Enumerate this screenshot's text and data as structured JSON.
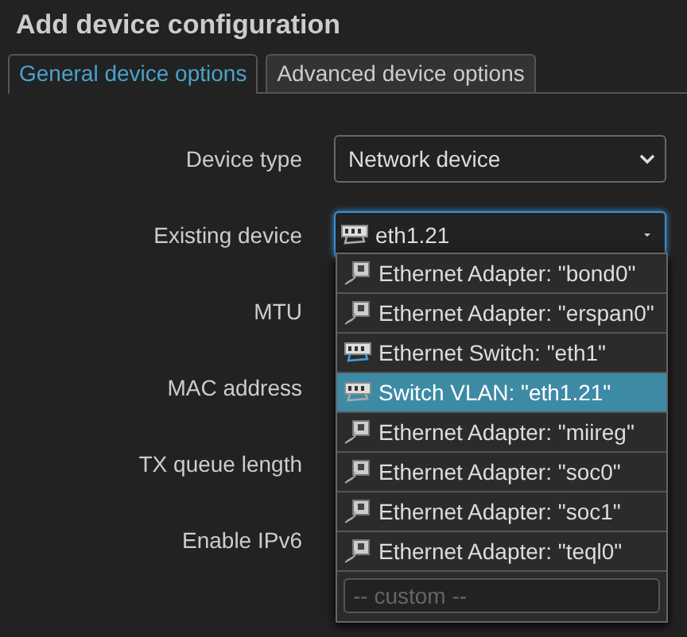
{
  "title": "Add device configuration",
  "tabs": [
    {
      "label": "General device options",
      "selected": true
    },
    {
      "label": "Advanced device options",
      "selected": false
    }
  ],
  "fields": [
    {
      "label": "Device type",
      "kind": "select",
      "value": "Network device"
    },
    {
      "label": "Existing device",
      "kind": "combo",
      "value": "eth1.21",
      "open": true
    },
    {
      "label": "MTU",
      "kind": "hidden"
    },
    {
      "label": "MAC address",
      "kind": "hidden"
    },
    {
      "label": "TX queue length",
      "kind": "hidden"
    },
    {
      "label": "Enable IPv6",
      "kind": "hidden"
    }
  ],
  "dropdown": {
    "items": [
      {
        "label": "Ethernet Adapter: \"bond0\"",
        "kind": "adapter",
        "selected": false
      },
      {
        "label": "Ethernet Adapter: \"erspan0\"",
        "kind": "adapter",
        "selected": false
      },
      {
        "label": "Ethernet Switch: \"eth1\"",
        "kind": "switch",
        "selected": false
      },
      {
        "label": "Switch VLAN: \"eth1.21\"",
        "kind": "vlan",
        "selected": true
      },
      {
        "label": "Ethernet Adapter: \"miireg\"",
        "kind": "adapter",
        "selected": false
      },
      {
        "label": "Ethernet Adapter: \"soc0\"",
        "kind": "adapter",
        "selected": false
      },
      {
        "label": "Ethernet Adapter: \"soc1\"",
        "kind": "adapter",
        "selected": false
      },
      {
        "label": "Ethernet Adapter: \"teql0\"",
        "kind": "adapter",
        "selected": false
      }
    ],
    "custom_placeholder": "-- custom --"
  }
}
